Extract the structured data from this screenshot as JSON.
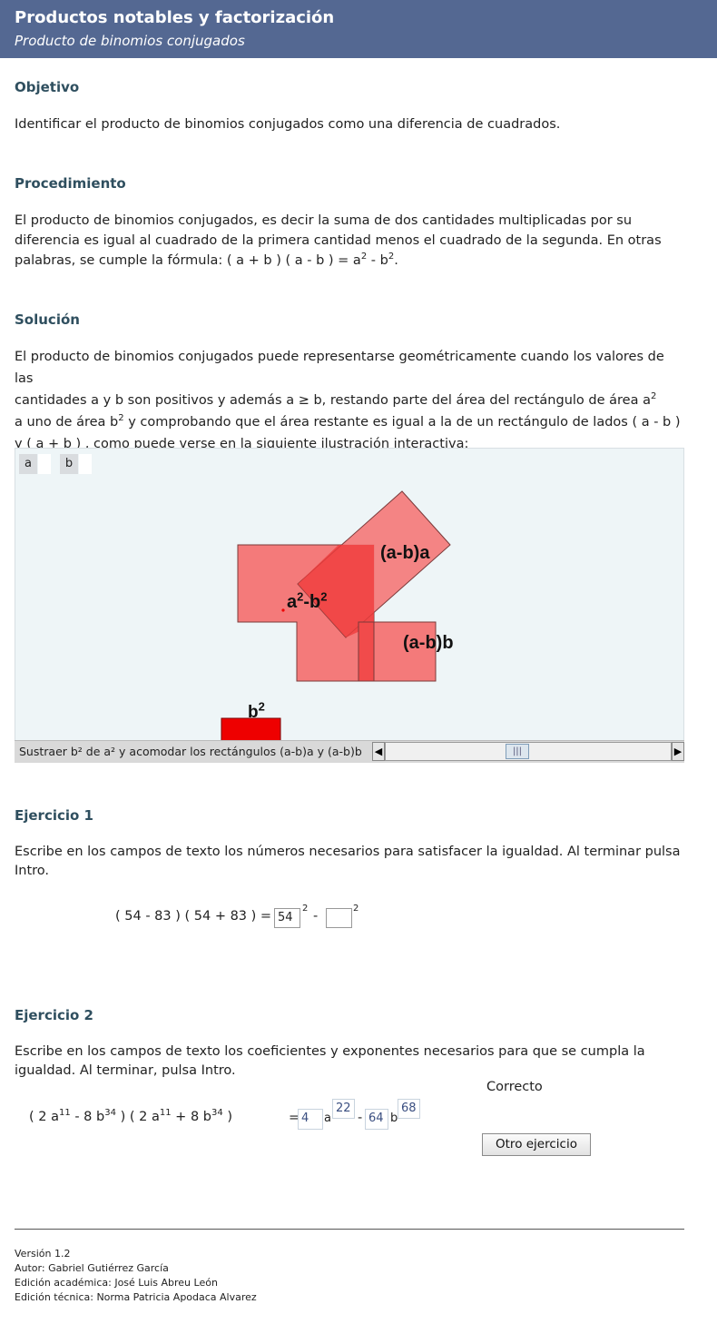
{
  "header": {
    "title": "Productos notables y factorización",
    "subtitle": "Producto de binomios conjugados"
  },
  "objetivo": {
    "heading": "Objetivo",
    "text": "Identificar el producto de binomios conjugados como una diferencia de cuadrados."
  },
  "procedimiento": {
    "heading": "Procedimiento",
    "line1": "El producto de binomios conjugados, es decir la suma de dos cantidades multiplicadas por su",
    "line2": "diferencia es igual al cuadrado de la primera cantidad menos el cuadrado de la segunda. En otras",
    "line3_pre": "palabras, se cumple la fórmula: ",
    "formula": "( a + b ) ( a - b ) = a",
    "formula_exp1": "2",
    "formula_mid": " - b",
    "formula_exp2": "2",
    "formula_end": "."
  },
  "solucion": {
    "heading": "Solución",
    "line1": "El producto de binomios conjugados puede representarse geométricamente cuando los valores de las",
    "line2_pre": "cantidades a  y b  son positivos y además  a ≥ b, restando parte del área del rectángulo de área a",
    "line2_exp": "2",
    "line3_pre": "a uno de área b",
    "line3_exp": "2",
    "line3_post": " y comprobando que el área restante es igual a la de un rectángulo de lados  ( a - b )",
    "line4": "y  ( a + b ) , como puede verse en la siguiente ilustración interactiva:"
  },
  "applet": {
    "param_a_label": "a",
    "param_b_label": "b",
    "label_ab_a": "(a-b)a",
    "label_diff_base_a": "a",
    "label_diff_exp1": "2",
    "label_diff_mid": "-b",
    "label_diff_exp2": "2",
    "label_ab_b": "(a-b)b",
    "label_b2_base": "b",
    "label_b2_exp": "2",
    "slider_caption": "Sustraer b² de a² y acomodar los rectángulos (a-b)a y (a-b)b",
    "slider_left": "◀",
    "slider_right": "▶",
    "slider_thumb": "|||",
    "slider_fraction": 0.46,
    "colors": {
      "rect": "#f47a7a",
      "overlap": "#f03c3c",
      "b2": "#ee0000"
    }
  },
  "ejercicio1": {
    "heading": "Ejercicio 1",
    "line1": "Escribe en los campos de texto los números necesarios para satisfacer la igualdad. Al terminar pulsa",
    "line2": "Intro.",
    "lhs": "( 54 - 83 ) ( 54 + 83 ) =",
    "field1_value": "54",
    "exp1": "2",
    "minus": "-",
    "field2_value": "",
    "exp2": "2"
  },
  "ejercicio2": {
    "heading": "Ejercicio 2",
    "line1": "Escribe en los campos de texto los coeficientes y exponentes necesarios para que se cumpla la",
    "line2": "igualdad. Al terminar, pulsa Intro.",
    "status": "Correcto",
    "lhs_p1": "( 2  a",
    "lhs_e1": "11",
    "lhs_p2": " - 8  b",
    "lhs_e2": "34",
    "lhs_p3": " ) ( 2  a",
    "lhs_e3": "11",
    "lhs_p4": " + 8  b",
    "lhs_e4": "34",
    "lhs_p5": " )",
    "eq": "=",
    "coef1": "4",
    "var_a": "a",
    "exp_a": "22",
    "minus": "-",
    "coef2": "64",
    "var_b": "b",
    "exp_b": "68",
    "button": "Otro ejercicio"
  },
  "footer": {
    "version": "Versión 1.2",
    "autor": "Autor: Gabriel Gutiérrez García",
    "academica": "Edición académica: José Luis Abreu León",
    "tecnica": "Edición técnica: Norma Patricia Apodaca Alvarez"
  }
}
